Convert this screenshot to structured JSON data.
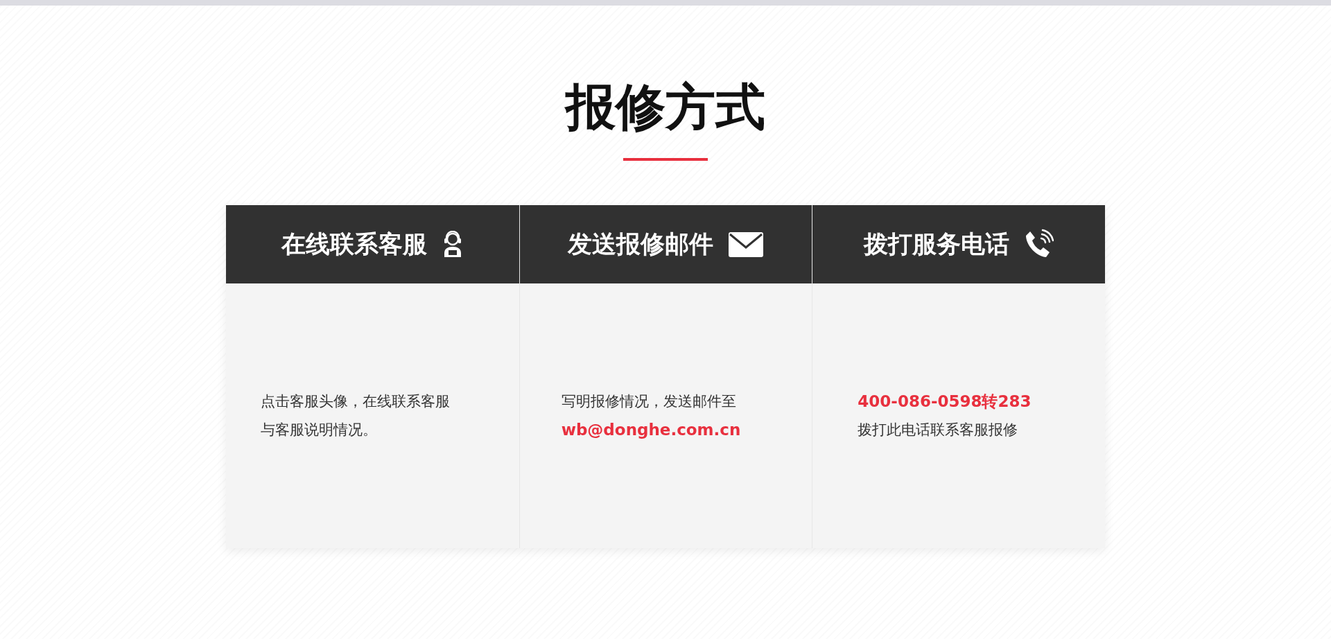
{
  "title": "报修方式",
  "methods": [
    {
      "heading": "在线联系客服",
      "kind": "agent",
      "lines": [
        {
          "kind": "text",
          "text": "点击客服头像，在线联系客服与客服说明情况。"
        }
      ]
    },
    {
      "heading": "发送报修邮件",
      "kind": "mail",
      "lines": [
        {
          "kind": "text",
          "text": "写明报修情况，发送邮件至"
        },
        {
          "kind": "highlight",
          "text": "wb@donghe.com.cn"
        }
      ]
    },
    {
      "heading": "拨打服务电话",
      "kind": "phone",
      "lines": [
        {
          "kind": "highlight",
          "text": "400-086-0598转283"
        },
        {
          "kind": "text",
          "text": "拨打此电话联系客服报修"
        }
      ]
    }
  ]
}
